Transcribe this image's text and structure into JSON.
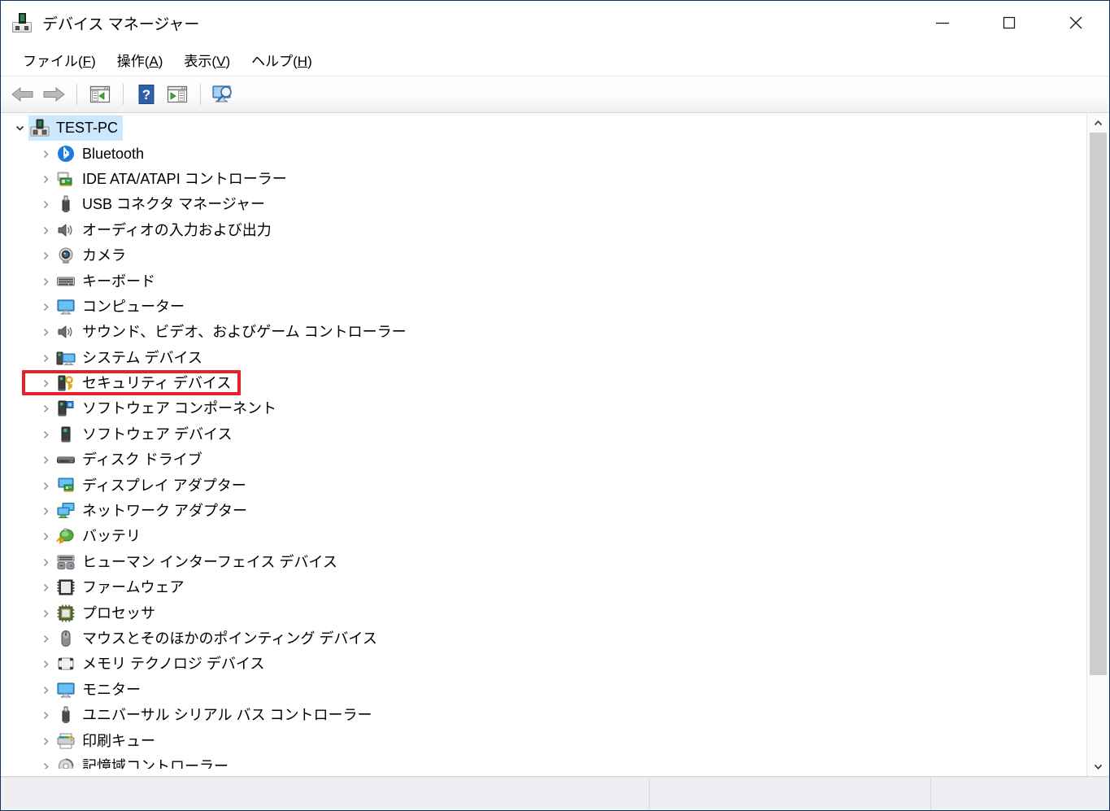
{
  "window": {
    "title": "デバイス マネージャー",
    "icon": "device-manager-icon",
    "controls": {
      "minimize": "最小化",
      "maximize": "最大化",
      "close": "閉じる"
    }
  },
  "menubar": {
    "items": [
      {
        "label": "ファイル(F)",
        "text": "ファイル(",
        "accel": "F",
        "tail": ")",
        "name": "menu-file"
      },
      {
        "label": "操作(A)",
        "text": "操作(",
        "accel": "A",
        "tail": ")",
        "name": "menu-action"
      },
      {
        "label": "表示(V)",
        "text": "表示(",
        "accel": "V",
        "tail": ")",
        "name": "menu-view"
      },
      {
        "label": "ヘルプ(H)",
        "text": "ヘルプ(",
        "accel": "H",
        "tail": ")",
        "name": "menu-help"
      }
    ]
  },
  "toolbar": {
    "buttons": [
      {
        "name": "back-button",
        "icon": "back-arrow-icon",
        "tooltip": "戻る"
      },
      {
        "name": "forward-button",
        "icon": "forward-arrow-icon",
        "tooltip": "進む"
      },
      {
        "name": "show-hide-console-tree-button",
        "icon": "console-tree-icon",
        "tooltip": "コンソール ツリーの表示/非表示"
      },
      {
        "name": "help-button",
        "icon": "help-question-icon",
        "tooltip": "ヘルプ"
      },
      {
        "name": "properties-button",
        "icon": "properties-icon",
        "tooltip": "プロパティ"
      },
      {
        "name": "scan-hardware-changes-button",
        "icon": "scan-monitor-icon",
        "tooltip": "ハードウェア変更のスキャン"
      }
    ]
  },
  "tree": {
    "root": {
      "label": "TEST-PC",
      "icon": "computer-device-icon",
      "expanded": true,
      "selected": true
    },
    "nodes": [
      {
        "label": "Bluetooth",
        "icon": "bluetooth-icon"
      },
      {
        "label": "IDE ATA/ATAPI コントローラー",
        "icon": "ide-controller-icon"
      },
      {
        "label": "USB コネクタ マネージャー",
        "icon": "usb-connector-icon"
      },
      {
        "label": "オーディオの入力および出力",
        "icon": "audio-speaker-icon"
      },
      {
        "label": "カメラ",
        "icon": "camera-icon"
      },
      {
        "label": "キーボード",
        "icon": "keyboard-icon"
      },
      {
        "label": "コンピューター",
        "icon": "monitor-icon"
      },
      {
        "label": "サウンド、ビデオ、およびゲーム コントローラー",
        "icon": "audio-speaker-icon"
      },
      {
        "label": "システム デバイス",
        "icon": "system-device-icon"
      },
      {
        "label": "セキュリティ デバイス",
        "icon": "security-device-icon",
        "highlighted": true
      },
      {
        "label": "ソフトウェア コンポーネント",
        "icon": "software-component-icon"
      },
      {
        "label": "ソフトウェア デバイス",
        "icon": "software-device-icon"
      },
      {
        "label": "ディスク ドライブ",
        "icon": "disk-drive-icon"
      },
      {
        "label": "ディスプレイ アダプター",
        "icon": "display-adapter-icon"
      },
      {
        "label": "ネットワーク アダプター",
        "icon": "network-adapter-icon"
      },
      {
        "label": "バッテリ",
        "icon": "battery-icon"
      },
      {
        "label": "ヒューマン インターフェイス デバイス",
        "icon": "hid-icon"
      },
      {
        "label": "ファームウェア",
        "icon": "firmware-chip-icon"
      },
      {
        "label": "プロセッサ",
        "icon": "processor-icon"
      },
      {
        "label": "マウスとそのほかのポインティング デバイス",
        "icon": "mouse-icon"
      },
      {
        "label": "メモリ テクノロジ デバイス",
        "icon": "memory-technology-icon"
      },
      {
        "label": "モニター",
        "icon": "monitor-icon"
      },
      {
        "label": "ユニバーサル シリアル バス コントローラー",
        "icon": "usb-connector-icon"
      },
      {
        "label": "印刷キュー",
        "icon": "printer-icon"
      },
      {
        "label": "記憶域コントローラー",
        "icon": "storage-controller-icon",
        "clipped": true
      }
    ]
  },
  "scrollbar": {
    "up_arrow": "scroll-up-arrow-icon",
    "down_arrow": "scroll-down-arrow-icon",
    "thumb_top_percent": 0,
    "thumb_height_percent": 87
  },
  "statusbar": {
    "panes": [
      "",
      "",
      ""
    ]
  },
  "annotation": {
    "highlight_color": "#e8202a",
    "target_label": "セキュリティ デバイス"
  },
  "colors": {
    "selection": "#cce8ff",
    "window_border": "#10335e",
    "statusbar_bg": "#f0eef2",
    "accent_red": "#e8202a"
  }
}
